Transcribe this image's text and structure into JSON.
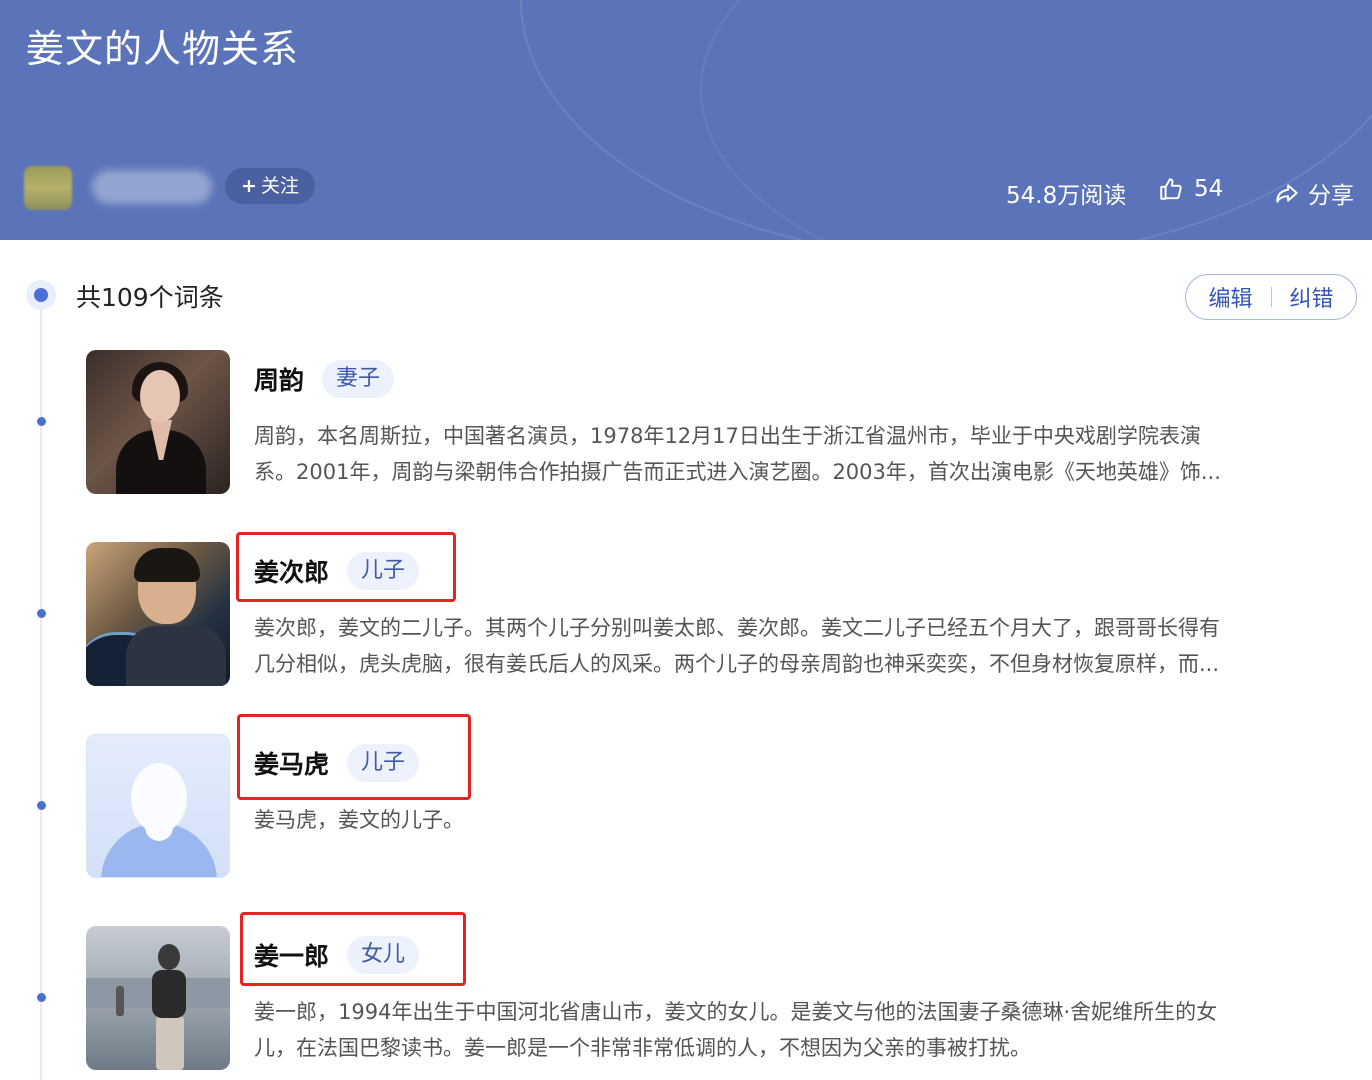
{
  "header": {
    "title": "姜文的人物关系",
    "follow_label": "关注",
    "read_count": "54.8万阅读",
    "like_count": "54",
    "share_label": "分享",
    "background_color": "#5b74b9"
  },
  "list": {
    "entry_count": "共109个词条",
    "edit_label": "编辑",
    "correct_label": "纠错",
    "accent_color": "#4b6fd6",
    "highlight_color": "#e42323",
    "items": [
      {
        "name": "周韵",
        "role": "妻子",
        "desc_line1": "周韵，本名周斯拉，中国著名演员，1978年12月17日出生于浙江省温州市，毕业于中央戏剧学院表演",
        "desc_line2": "系。2001年，周韵与梁朝伟合作拍摄广告而正式进入演艺圈。2003年，首次出演电影《天地英雄》饰...",
        "highlighted": false
      },
      {
        "name": "姜次郎",
        "role": "儿子",
        "desc_line1": "姜次郎，姜文的二儿子。其两个儿子分别叫姜太郎、姜次郎。姜文二儿子已经五个月大了，跟哥哥长得有",
        "desc_line2": "几分相似，虎头虎脑，很有姜氏后人的风采。两个儿子的母亲周韵也神采奕奕，不但身材恢复原样，而...",
        "highlighted": true
      },
      {
        "name": "姜马虎",
        "role": "儿子",
        "desc_line1": "姜马虎，姜文的儿子。",
        "desc_line2": "",
        "highlighted": true
      },
      {
        "name": "姜一郎",
        "role": "女儿",
        "desc_line1": "姜一郎，1994年出生于中国河北省唐山市，姜文的女儿。是姜文与他的法国妻子桑德琳·舍妮维所生的女",
        "desc_line2": "儿，在法国巴黎读书。姜一郎是一个非常非常低调的人，不想因为父亲的事被打扰。",
        "highlighted": true
      }
    ]
  }
}
